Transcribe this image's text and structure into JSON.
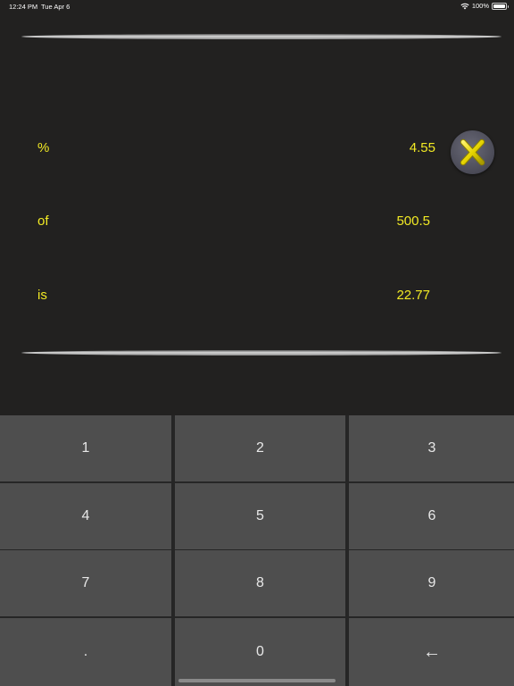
{
  "status_bar": {
    "time": "12:24 PM",
    "date": "Tue Apr 6",
    "battery": "100%"
  },
  "calculator": {
    "rows": [
      {
        "label": "%",
        "value": "4.55"
      },
      {
        "label": "of",
        "value": "500.5"
      },
      {
        "label": "is",
        "value": "22.77"
      }
    ],
    "clear_icon": "close-x-icon"
  },
  "keypad": {
    "keys": [
      "1",
      "2",
      "3",
      "4",
      "5",
      "6",
      "7",
      "8",
      "9",
      ".",
      "0",
      "←"
    ]
  },
  "colors": {
    "background": "#222120",
    "accent_text": "#f2ea24",
    "key_background": "#4e4e4e",
    "clear_button": "#55555f"
  }
}
